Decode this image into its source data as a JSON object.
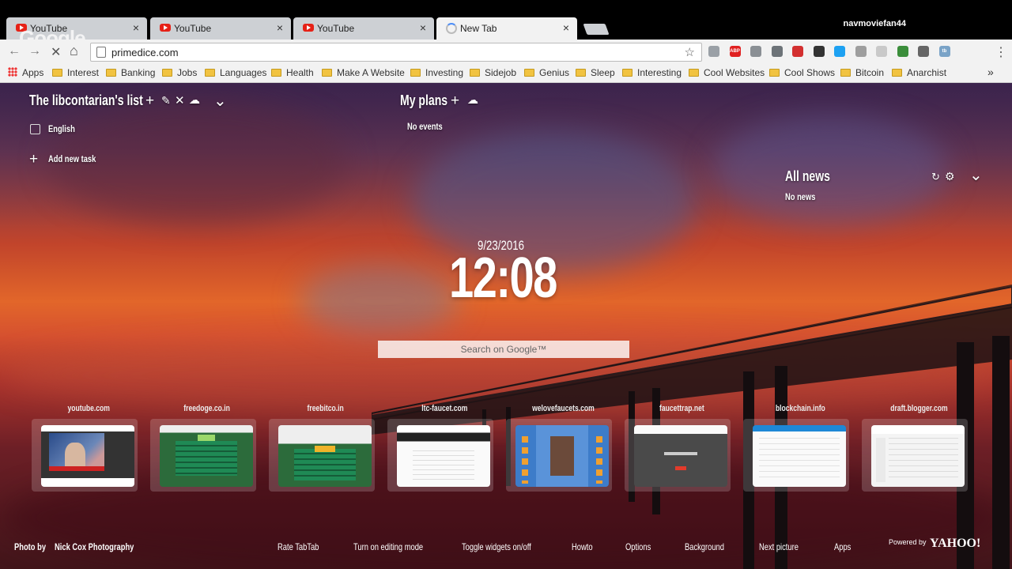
{
  "browser": {
    "tabs": [
      {
        "title": "YouTube",
        "close": "×"
      },
      {
        "title": "YouTube",
        "close": "×"
      },
      {
        "title": "YouTube",
        "close": "×"
      },
      {
        "title": "New Tab",
        "close": "×"
      }
    ],
    "overlay_logo": "Google",
    "user": "navmoviefan44",
    "url": "primedice.com",
    "back": "←",
    "forward": "→",
    "reload": "✕",
    "home": "⌂",
    "star": "☆",
    "menu_dots": "⋮",
    "extensions": [
      {
        "icon": "shield-icon",
        "color": "#9aa0a6"
      },
      {
        "icon": "adblock-icon",
        "color": "#e02020",
        "label": "ABP"
      },
      {
        "icon": "cloud-icon",
        "color": "#8a8f94"
      },
      {
        "icon": "diamond-icon",
        "color": "#6d7378"
      },
      {
        "icon": "bookmark-red-icon",
        "color": "#d32f2f"
      },
      {
        "icon": "circle-dark-icon",
        "color": "#333333"
      },
      {
        "icon": "skype-icon",
        "color": "#1da1f2"
      },
      {
        "icon": "globe-icon",
        "color": "#9e9e9e"
      },
      {
        "icon": "square-icon",
        "color": "#c9c9c9"
      },
      {
        "icon": "photo-icon",
        "color": "#3b8e3b"
      },
      {
        "icon": "cast-icon",
        "color": "#666666"
      },
      {
        "icon": "tb-icon",
        "color": "#7aa3c7",
        "label": "tb"
      }
    ],
    "bookmarks": [
      "Apps",
      "Interest",
      "Banking",
      "Jobs",
      "Languages",
      "Health",
      "Make A Website",
      "Investing",
      "Sidejob",
      "Genius",
      "Sleep",
      "Interesting",
      "Cool Websites",
      "Cool Shows",
      "Bitcoin",
      "Anarchist"
    ],
    "bookmarks_more": "»"
  },
  "page": {
    "todo": {
      "title": "The libcontarian's list",
      "actions": [
        "+",
        "✎",
        "✕",
        "☁"
      ],
      "chevron": "⌄",
      "tasks": [
        {
          "label": "English",
          "done": false
        }
      ],
      "add_label": "Add new task",
      "add_icon": "+"
    },
    "plans": {
      "title": "My plans",
      "plus": "+",
      "cloud": "☁",
      "empty": "No events"
    },
    "news": {
      "title": "All news",
      "refresh": "↻",
      "gear": "⚙",
      "chevron": "⌄",
      "empty": "No news"
    },
    "date": "9/23/2016",
    "time": "12:08",
    "search_placeholder": "Search on Google™",
    "speed_dial": [
      {
        "label": "youtube.com"
      },
      {
        "label": "freedoge.co.in"
      },
      {
        "label": "freebitco.in"
      },
      {
        "label": "ltc-faucet.com"
      },
      {
        "label": "welovefaucets.com"
      },
      {
        "label": "faucettrap.net"
      },
      {
        "label": "blockchain.info"
      },
      {
        "label": "draft.blogger.com"
      }
    ],
    "footer": {
      "photo_by": "Photo by",
      "photographer": "Nick Cox Photography",
      "links": [
        "Rate TabTab",
        "Turn on editing mode",
        "Toggle widgets on/off",
        "Howto",
        "Options",
        "Background",
        "Next picture",
        "Apps"
      ],
      "powered_by": "Powered by",
      "brand": "YAHOO!"
    }
  }
}
